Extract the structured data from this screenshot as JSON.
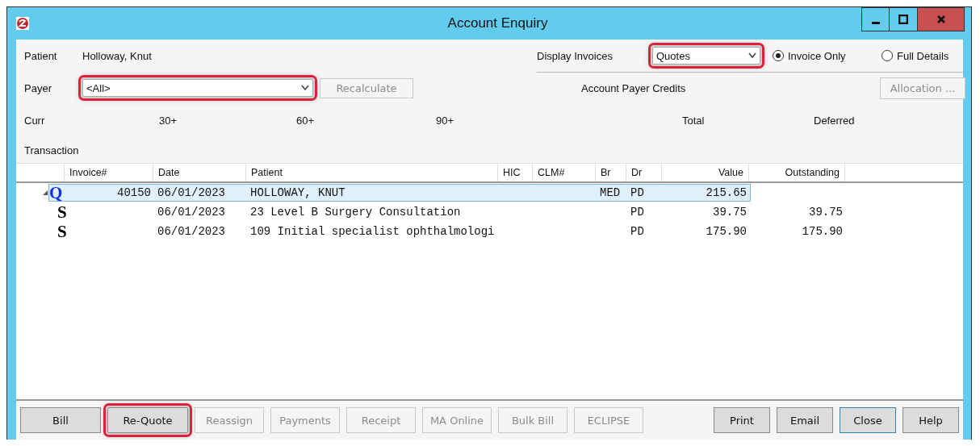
{
  "window": {
    "title": "Account Enquiry"
  },
  "patient": {
    "label": "Patient",
    "value": "Holloway, Knut"
  },
  "display_invoices": {
    "label": "Display Invoices",
    "value": "Quotes",
    "highlighted": true
  },
  "view_options": [
    {
      "label": "Invoice Only",
      "selected": true
    },
    {
      "label": "Full Details",
      "selected": false
    }
  ],
  "payer": {
    "label": "Payer",
    "value": "<All>",
    "highlighted": true
  },
  "recalculate": {
    "label": "Recalculate",
    "disabled": true
  },
  "account_payer_credits": "Account Payer Credits",
  "allocation": {
    "label": "Allocation ...",
    "disabled": true
  },
  "aging": [
    "Curr",
    "30+",
    "60+",
    "90+",
    "Total",
    "Deferred"
  ],
  "transaction_label": "Transaction",
  "table": {
    "columns": [
      "Invoice#",
      "Date",
      "Patient",
      "HIC",
      "CLM#",
      "Br",
      "Dr",
      "Value",
      "Outstanding"
    ],
    "rows": [
      {
        "mark": "Q",
        "expanded": true,
        "selected": true,
        "invoice": "40150",
        "date": "06/01/2023",
        "patient": "HOLLOWAY, KNUT",
        "br": "MED",
        "dr": "PD",
        "value": "215.65",
        "children": [
          {
            "mark": "S",
            "date": "06/01/2023",
            "patient": "23 Level B Surgery Consultation",
            "dr": "PD",
            "value": "39.75",
            "outstanding": "39.75"
          },
          {
            "mark": "S",
            "date": "06/01/2023",
            "patient": "109 Initial specialist ophthalmologi",
            "dr": "PD",
            "value": "175.90",
            "outstanding": "175.90"
          }
        ]
      }
    ]
  },
  "buttons": [
    {
      "label": "Bill",
      "disabled": false,
      "highlighted": false
    },
    {
      "label": "Re-Quote",
      "disabled": false,
      "highlighted": true
    },
    {
      "label": "Reassign",
      "disabled": true,
      "highlighted": false
    },
    {
      "label": "Payments",
      "disabled": true,
      "highlighted": false
    },
    {
      "label": "Receipt",
      "disabled": true,
      "highlighted": false
    },
    {
      "label": "MA Online",
      "disabled": true,
      "highlighted": false
    },
    {
      "label": "Bulk Bill",
      "disabled": true,
      "highlighted": false
    },
    {
      "label": "ECLIPSE",
      "disabled": true,
      "highlighted": false
    }
  ],
  "right_buttons": [
    {
      "label": "Print",
      "focused": false
    },
    {
      "label": "Email",
      "focused": false
    },
    {
      "label": "Close",
      "focused": true
    },
    {
      "label": "Help",
      "focused": false
    }
  ]
}
